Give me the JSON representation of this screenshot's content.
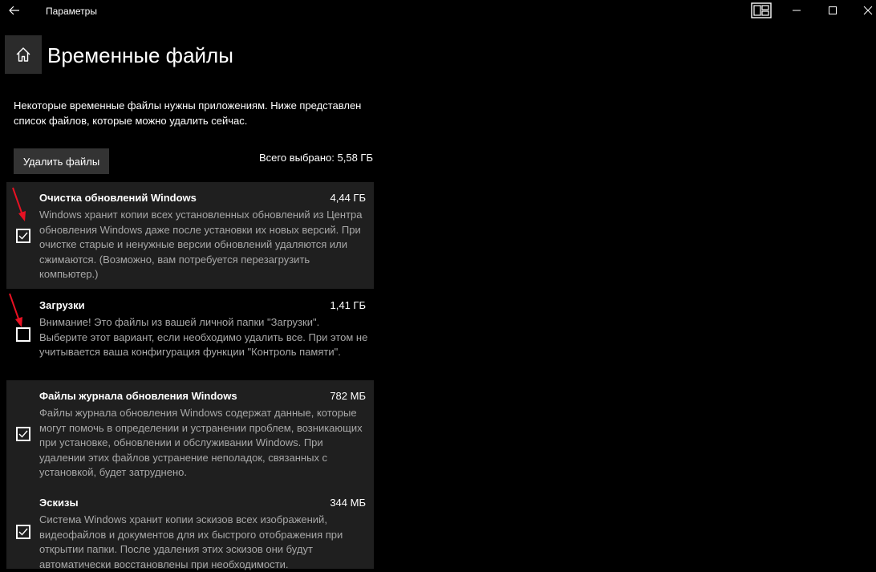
{
  "window": {
    "app_title": "Параметры",
    "controls": [
      "snap-layout-icon",
      "minimize-icon",
      "maximize-icon",
      "close-icon"
    ]
  },
  "header": {
    "title": "Временные файлы"
  },
  "description": "Некоторые временные файлы нужны приложениям. Ниже представлен список файлов, которые можно удалить сейчас.",
  "actions": {
    "delete_label": "Удалить файлы",
    "total_selected": "Всего выбрано: 5,58 ГБ"
  },
  "items": [
    {
      "title": "Очистка обновлений Windows",
      "size": "4,44 ГБ",
      "checked": true,
      "description": "Windows хранит копии всех установленных обновлений из Центра обновления Windows даже после установки их новых версий. При очистке старые и ненужные версии обновлений удаляются или сжимаются. (Возможно, вам потребуется перезагрузить компьютер.)"
    },
    {
      "title": "Загрузки",
      "size": "1,41 ГБ",
      "checked": false,
      "description": "Внимание! Это файлы из вашей личной папки \"Загрузки\". Выберите этот вариант, если необходимо удалить все. При этом не учитывается ваша конфигурация функции \"Контроль памяти\"."
    },
    {
      "title": "Файлы журнала обновления Windows",
      "size": "782 МБ",
      "checked": true,
      "description": "Файлы журнала обновления Windows содержат данные, которые могут помочь в определении и устранении проблем, возникающих при установке, обновлении и обслуживании Windows. При удалении этих файлов устранение неполадок, связанных с установкой, будет затруднено."
    },
    {
      "title": "Эскизы",
      "size": "344 МБ",
      "checked": true,
      "description": "Система Windows хранит копии эскизов всех изображений, видеофайлов и документов для их быстрого отображения при открытии папки. После удаления этих эскизов они будут автоматически восстановлены при необходимости."
    }
  ],
  "colors": {
    "background": "#000000",
    "item_background": "#1f1f1f",
    "button_background": "#333333",
    "secondary_text": "#a8a8a8",
    "annotation_arrow": "#e81123"
  }
}
